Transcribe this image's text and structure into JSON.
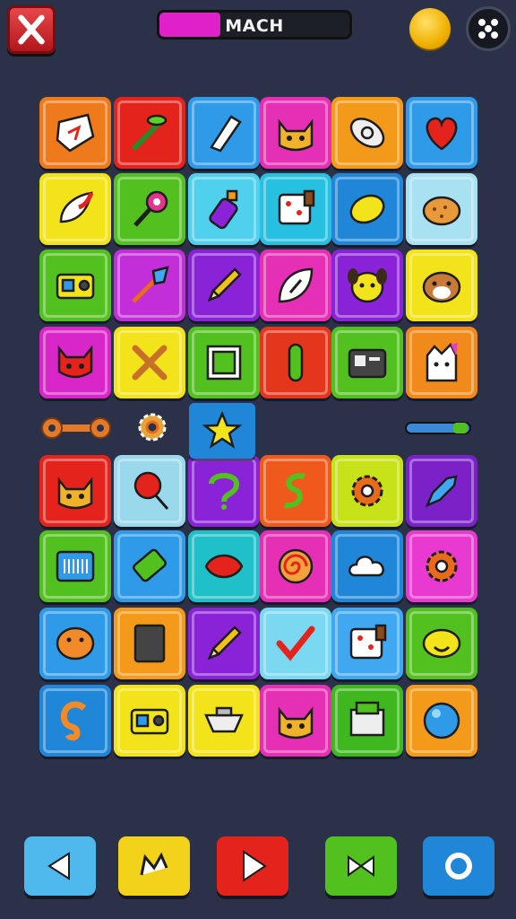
{
  "header": {
    "close_icon": "close-x-icon",
    "progress_label": "MACH",
    "progress_value": 0.32,
    "progress_color": "#e020c8",
    "coin_icon": "gold-coin-icon",
    "menu_icon": "dice-icon"
  },
  "board": {
    "columns": 6,
    "rows_above_gap": 4,
    "rows_below_gap": 4,
    "tiles": [
      [
        {
          "color": "#ef7a1c",
          "icon": "paper-scrap-icon"
        },
        {
          "color": "#e3231c",
          "icon": "branch-icon"
        },
        {
          "color": "#2f9be8",
          "icon": "paper-roll-icon"
        },
        {
          "color": "#e52fb4",
          "icon": "cat-face-icon"
        },
        {
          "color": "#f39a1a",
          "icon": "fossil-icon"
        },
        {
          "color": "#2f9be8",
          "icon": "heart-icon"
        }
      ],
      [
        {
          "color": "#f2e31a",
          "icon": "feather-icon"
        },
        {
          "color": "#52c01f",
          "icon": "pin-wheel-icon"
        },
        {
          "color": "#4fd0ec",
          "icon": "bottle-icon"
        },
        {
          "color": "#27c0e0",
          "icon": "dice-box-icon"
        },
        {
          "color": "#1f86d8",
          "icon": "lemon-icon"
        },
        {
          "color": "#a8e1f2",
          "icon": "cookie-icon"
        }
      ],
      [
        {
          "color": "#52c01f",
          "icon": "radio-icon"
        },
        {
          "color": "#c22fd8",
          "icon": "dart-icon"
        },
        {
          "color": "#8a22d8",
          "icon": "pencil-icon"
        },
        {
          "color": "#e52fb4",
          "icon": "leaf-icon"
        },
        {
          "color": "#8a22d8",
          "icon": "dog-face-icon"
        },
        {
          "color": "#f2e31a",
          "icon": "hamster-face-icon"
        }
      ],
      [
        {
          "color": "#d826c8",
          "icon": "devil-face-icon"
        },
        {
          "color": "#f2e31a",
          "icon": "crossed-tools-icon"
        },
        {
          "color": "#52c01f",
          "icon": "photo-frame-icon"
        },
        {
          "color": "#e3361c",
          "icon": "tube-icon"
        },
        {
          "color": "#52c01f",
          "icon": "camera-icon"
        },
        {
          "color": "#f08a1a",
          "icon": "ghost-cat-icon"
        }
      ],
      [
        {
          "color": "#e3231c",
          "icon": "cat-face-icon"
        },
        {
          "color": "#9ad8ec",
          "icon": "lollipop-icon"
        },
        {
          "color": "#8a22d8",
          "icon": "hook-icon"
        },
        {
          "color": "#ef5a1c",
          "icon": "swirl-s-icon"
        },
        {
          "color": "#c8e21a",
          "icon": "gear-icon"
        },
        {
          "color": "#7a22c8",
          "icon": "rocket-icon"
        }
      ],
      [
        {
          "color": "#52c01f",
          "icon": "barcode-screen-icon"
        },
        {
          "color": "#2f9be8",
          "icon": "battery-icon"
        },
        {
          "color": "#1fc0c8",
          "icon": "lips-icon"
        },
        {
          "color": "#e52fb4",
          "icon": "spiral-icon"
        },
        {
          "color": "#1f86d8",
          "icon": "cloud-icon"
        },
        {
          "color": "#e83ad0",
          "icon": "gear-icon"
        }
      ],
      [
        {
          "color": "#2f9be8",
          "icon": "blob-face-icon"
        },
        {
          "color": "#f39a1a",
          "icon": "book-icon"
        },
        {
          "color": "#8a22d8",
          "icon": "pencil-icon"
        },
        {
          "color": "#7ad8f0",
          "icon": "checkmark-icon"
        },
        {
          "color": "#3fa8f0",
          "icon": "dice-box-icon"
        },
        {
          "color": "#52c01f",
          "icon": "smile-blob-icon"
        }
      ],
      [
        {
          "color": "#1f86d8",
          "icon": "ear-icon"
        },
        {
          "color": "#f2e31a",
          "icon": "radio-icon"
        },
        {
          "color": "#f2e31a",
          "icon": "bowl-icon"
        },
        {
          "color": "#e52fb4",
          "icon": "cat-face-icon"
        },
        {
          "color": "#3fb81f",
          "icon": "printer-icon"
        },
        {
          "color": "#f39a1a",
          "icon": "ball-icon"
        }
      ]
    ],
    "gap_row": {
      "left": "pipe-connector-icon",
      "second": "small-gear-icon",
      "center": "star-icon",
      "right": "rail-icon"
    }
  },
  "footer": {
    "buttons": [
      {
        "name": "back-button",
        "color": "#4fb8ec",
        "icon": "triangle-left-icon"
      },
      {
        "name": "skip-button",
        "color": "#f2d21a",
        "icon": "crown-arrow-icon"
      },
      {
        "name": "play-button",
        "color": "#e3231c",
        "icon": "play-icon"
      },
      {
        "name": "shuffle-button",
        "color": "#52c01f",
        "icon": "shuffle-icon"
      },
      {
        "name": "hint-button",
        "color": "#1f86d8",
        "icon": "ring-icon"
      }
    ]
  }
}
